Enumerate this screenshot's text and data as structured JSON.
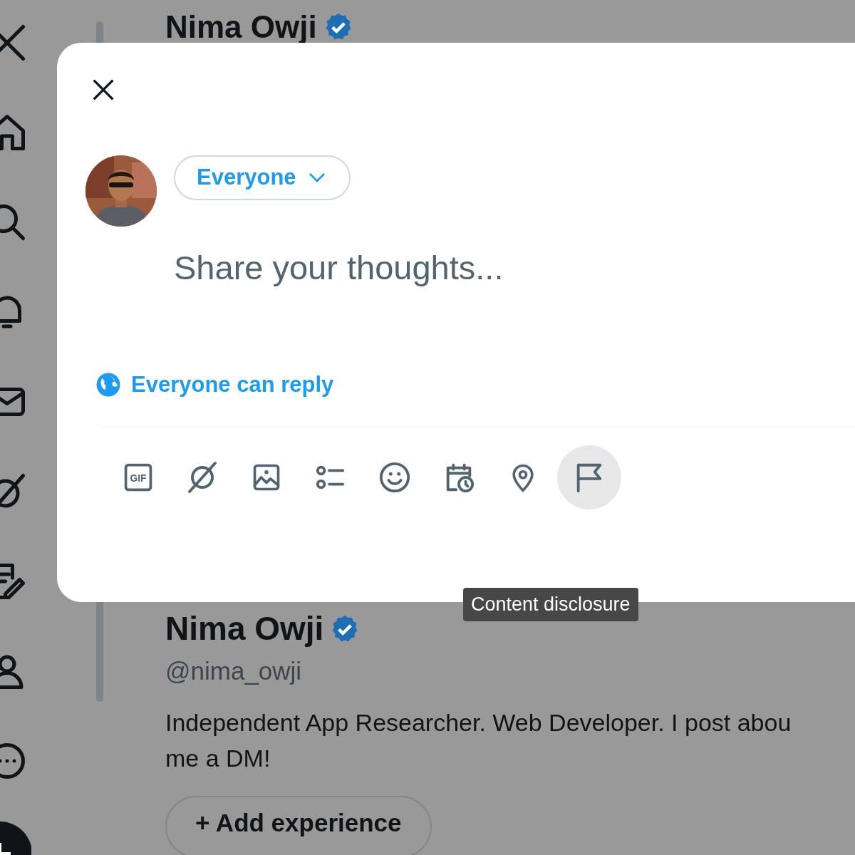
{
  "background_profile": {
    "header_name": "Nima Owji",
    "name": "Nima Owji",
    "verified": true,
    "handle": "@nima_owji",
    "bio": "Independent App Researcher. Web Developer. I post abou\nme a DM!",
    "add_button": "+ Add experience"
  },
  "composer": {
    "audience": "Everyone",
    "placeholder": "Share your thoughts...",
    "reply_setting": "Everyone can reply",
    "tools": [
      {
        "kind": "gif",
        "label": "GIF",
        "hovered": false
      },
      {
        "kind": "grok",
        "hovered": false
      },
      {
        "kind": "media",
        "hovered": false
      },
      {
        "kind": "poll",
        "hovered": false
      },
      {
        "kind": "emoji",
        "hovered": false
      },
      {
        "kind": "schedule",
        "hovered": false
      },
      {
        "kind": "location",
        "hovered": false
      },
      {
        "kind": "flag",
        "hovered": true
      }
    ],
    "tooltip": "Content disclosure"
  }
}
